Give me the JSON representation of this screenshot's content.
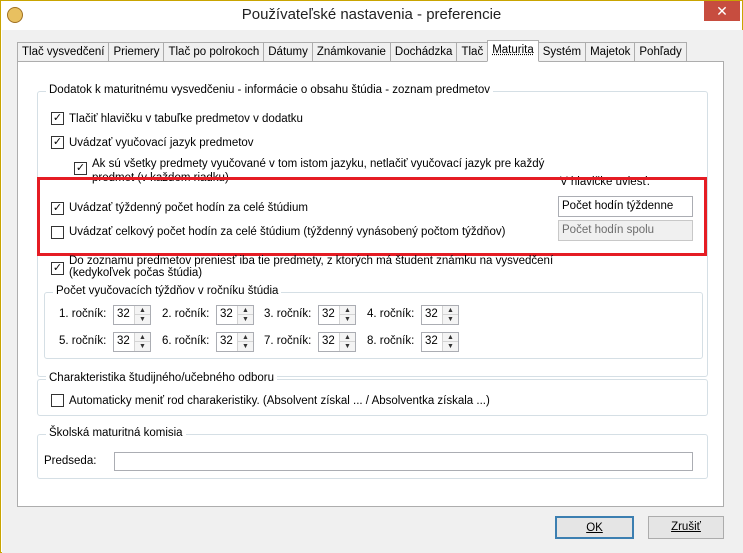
{
  "window": {
    "title": "Používateľské nastavenia - preferencie",
    "close_glyph": "✕"
  },
  "tabs": [
    "Tlač vysvedčení",
    "Priemery",
    "Tlač po polrokoch",
    "Dátumy",
    "Známkovanie",
    "Dochádzka",
    "Tlač",
    "Maturita",
    "Systém",
    "Majetok",
    "Pohľady"
  ],
  "active_tab": "Maturita",
  "group1": {
    "label": "Dodatok k maturitnému vysvedčeniu - informácie o obsahu štúdia - zoznam predmetov",
    "opt1": {
      "label": "Tlačiť hlavičku v tabuľke predmetov v dodatku",
      "checked": true
    },
    "opt2": {
      "label": "Uvádzať vyučovací jazyk predmetov",
      "checked": true
    },
    "opt3": {
      "label_line1": "Ak sú všetky predmety vyučované v tom istom jazyku, netlačiť vyučovací jazyk pre každý",
      "label_line2": "predmet (v každom riadku)",
      "checked": true
    },
    "header_caption": "V hlavičke uviesť:",
    "opt4": {
      "label": "Uvádzať týždenný počet hodín za celé štúdium",
      "checked": true,
      "value": "Počet hodín týždenne"
    },
    "opt5": {
      "label": "Uvádzať celkový počet hodín za celé štúdium (týždenný vynásobený počtom týždňov)",
      "checked": false,
      "value": "Počet hodín spolu"
    },
    "opt6": {
      "label_line1": "Do zoznamu predmetov preniesť iba tie predmety, z ktorých má študent známku na vysvedčení",
      "label_line2": "(kedykoľvek počas štúdia)",
      "checked": true
    }
  },
  "weeks": {
    "label": "Počet vyučovacích týždňov v ročníku štúdia",
    "items": [
      {
        "label": "1. ročník:",
        "value": "32"
      },
      {
        "label": "2. ročník:",
        "value": "32"
      },
      {
        "label": "3. ročník:",
        "value": "32"
      },
      {
        "label": "4. ročník:",
        "value": "32"
      },
      {
        "label": "5. ročník:",
        "value": "32"
      },
      {
        "label": "6. ročník:",
        "value": "32"
      },
      {
        "label": "7. ročník:",
        "value": "32"
      },
      {
        "label": "8. ročník:",
        "value": "32"
      }
    ]
  },
  "group2": {
    "label": "Charakteristika študijného/učebného odboru",
    "opt": {
      "label": "Automaticky meniť rod charakeristiky. (Absolvent získal ... / Absolventka získala ...)",
      "checked": false
    }
  },
  "group3": {
    "label": "Školská maturitná komisia",
    "chair_label": "Predseda:",
    "chair_value": ""
  },
  "buttons": {
    "ok": "OK",
    "cancel": "Zrušiť"
  }
}
